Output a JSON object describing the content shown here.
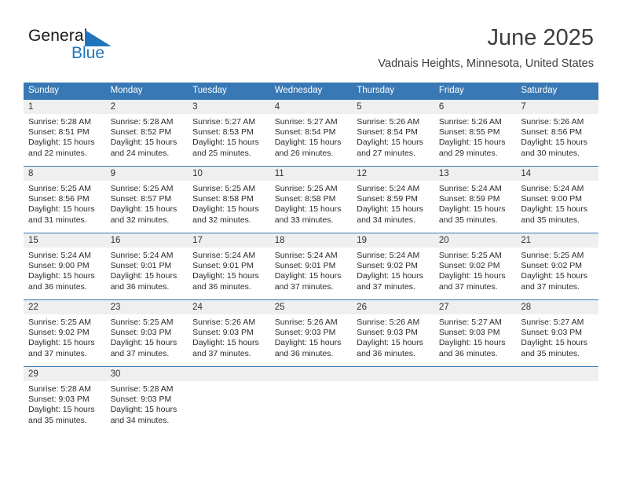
{
  "brand": {
    "name_part1": "General",
    "name_part2": "Blue",
    "mark": "triangle-logo-icon",
    "accent_color": "#2175bc"
  },
  "header": {
    "month_title": "June 2025",
    "location": "Vadnais Heights, Minnesota, United States"
  },
  "colors": {
    "header_row": "#3878b4",
    "day_band": "#efefef",
    "text": "#2b2b2b"
  },
  "weekday_headers": [
    "Sunday",
    "Monday",
    "Tuesday",
    "Wednesday",
    "Thursday",
    "Friday",
    "Saturday"
  ],
  "weeks": [
    [
      {
        "day": "1",
        "sunrise": "Sunrise: 5:28 AM",
        "sunset": "Sunset: 8:51 PM",
        "daylight1": "Daylight: 15 hours",
        "daylight2": "and 22 minutes."
      },
      {
        "day": "2",
        "sunrise": "Sunrise: 5:28 AM",
        "sunset": "Sunset: 8:52 PM",
        "daylight1": "Daylight: 15 hours",
        "daylight2": "and 24 minutes."
      },
      {
        "day": "3",
        "sunrise": "Sunrise: 5:27 AM",
        "sunset": "Sunset: 8:53 PM",
        "daylight1": "Daylight: 15 hours",
        "daylight2": "and 25 minutes."
      },
      {
        "day": "4",
        "sunrise": "Sunrise: 5:27 AM",
        "sunset": "Sunset: 8:54 PM",
        "daylight1": "Daylight: 15 hours",
        "daylight2": "and 26 minutes."
      },
      {
        "day": "5",
        "sunrise": "Sunrise: 5:26 AM",
        "sunset": "Sunset: 8:54 PM",
        "daylight1": "Daylight: 15 hours",
        "daylight2": "and 27 minutes."
      },
      {
        "day": "6",
        "sunrise": "Sunrise: 5:26 AM",
        "sunset": "Sunset: 8:55 PM",
        "daylight1": "Daylight: 15 hours",
        "daylight2": "and 29 minutes."
      },
      {
        "day": "7",
        "sunrise": "Sunrise: 5:26 AM",
        "sunset": "Sunset: 8:56 PM",
        "daylight1": "Daylight: 15 hours",
        "daylight2": "and 30 minutes."
      }
    ],
    [
      {
        "day": "8",
        "sunrise": "Sunrise: 5:25 AM",
        "sunset": "Sunset: 8:56 PM",
        "daylight1": "Daylight: 15 hours",
        "daylight2": "and 31 minutes."
      },
      {
        "day": "9",
        "sunrise": "Sunrise: 5:25 AM",
        "sunset": "Sunset: 8:57 PM",
        "daylight1": "Daylight: 15 hours",
        "daylight2": "and 32 minutes."
      },
      {
        "day": "10",
        "sunrise": "Sunrise: 5:25 AM",
        "sunset": "Sunset: 8:58 PM",
        "daylight1": "Daylight: 15 hours",
        "daylight2": "and 32 minutes."
      },
      {
        "day": "11",
        "sunrise": "Sunrise: 5:25 AM",
        "sunset": "Sunset: 8:58 PM",
        "daylight1": "Daylight: 15 hours",
        "daylight2": "and 33 minutes."
      },
      {
        "day": "12",
        "sunrise": "Sunrise: 5:24 AM",
        "sunset": "Sunset: 8:59 PM",
        "daylight1": "Daylight: 15 hours",
        "daylight2": "and 34 minutes."
      },
      {
        "day": "13",
        "sunrise": "Sunrise: 5:24 AM",
        "sunset": "Sunset: 8:59 PM",
        "daylight1": "Daylight: 15 hours",
        "daylight2": "and 35 minutes."
      },
      {
        "day": "14",
        "sunrise": "Sunrise: 5:24 AM",
        "sunset": "Sunset: 9:00 PM",
        "daylight1": "Daylight: 15 hours",
        "daylight2": "and 35 minutes."
      }
    ],
    [
      {
        "day": "15",
        "sunrise": "Sunrise: 5:24 AM",
        "sunset": "Sunset: 9:00 PM",
        "daylight1": "Daylight: 15 hours",
        "daylight2": "and 36 minutes."
      },
      {
        "day": "16",
        "sunrise": "Sunrise: 5:24 AM",
        "sunset": "Sunset: 9:01 PM",
        "daylight1": "Daylight: 15 hours",
        "daylight2": "and 36 minutes."
      },
      {
        "day": "17",
        "sunrise": "Sunrise: 5:24 AM",
        "sunset": "Sunset: 9:01 PM",
        "daylight1": "Daylight: 15 hours",
        "daylight2": "and 36 minutes."
      },
      {
        "day": "18",
        "sunrise": "Sunrise: 5:24 AM",
        "sunset": "Sunset: 9:01 PM",
        "daylight1": "Daylight: 15 hours",
        "daylight2": "and 37 minutes."
      },
      {
        "day": "19",
        "sunrise": "Sunrise: 5:24 AM",
        "sunset": "Sunset: 9:02 PM",
        "daylight1": "Daylight: 15 hours",
        "daylight2": "and 37 minutes."
      },
      {
        "day": "20",
        "sunrise": "Sunrise: 5:25 AM",
        "sunset": "Sunset: 9:02 PM",
        "daylight1": "Daylight: 15 hours",
        "daylight2": "and 37 minutes."
      },
      {
        "day": "21",
        "sunrise": "Sunrise: 5:25 AM",
        "sunset": "Sunset: 9:02 PM",
        "daylight1": "Daylight: 15 hours",
        "daylight2": "and 37 minutes."
      }
    ],
    [
      {
        "day": "22",
        "sunrise": "Sunrise: 5:25 AM",
        "sunset": "Sunset: 9:02 PM",
        "daylight1": "Daylight: 15 hours",
        "daylight2": "and 37 minutes."
      },
      {
        "day": "23",
        "sunrise": "Sunrise: 5:25 AM",
        "sunset": "Sunset: 9:03 PM",
        "daylight1": "Daylight: 15 hours",
        "daylight2": "and 37 minutes."
      },
      {
        "day": "24",
        "sunrise": "Sunrise: 5:26 AM",
        "sunset": "Sunset: 9:03 PM",
        "daylight1": "Daylight: 15 hours",
        "daylight2": "and 37 minutes."
      },
      {
        "day": "25",
        "sunrise": "Sunrise: 5:26 AM",
        "sunset": "Sunset: 9:03 PM",
        "daylight1": "Daylight: 15 hours",
        "daylight2": "and 36 minutes."
      },
      {
        "day": "26",
        "sunrise": "Sunrise: 5:26 AM",
        "sunset": "Sunset: 9:03 PM",
        "daylight1": "Daylight: 15 hours",
        "daylight2": "and 36 minutes."
      },
      {
        "day": "27",
        "sunrise": "Sunrise: 5:27 AM",
        "sunset": "Sunset: 9:03 PM",
        "daylight1": "Daylight: 15 hours",
        "daylight2": "and 36 minutes."
      },
      {
        "day": "28",
        "sunrise": "Sunrise: 5:27 AM",
        "sunset": "Sunset: 9:03 PM",
        "daylight1": "Daylight: 15 hours",
        "daylight2": "and 35 minutes."
      }
    ],
    [
      {
        "day": "29",
        "sunrise": "Sunrise: 5:28 AM",
        "sunset": "Sunset: 9:03 PM",
        "daylight1": "Daylight: 15 hours",
        "daylight2": "and 35 minutes."
      },
      {
        "day": "30",
        "sunrise": "Sunrise: 5:28 AM",
        "sunset": "Sunset: 9:03 PM",
        "daylight1": "Daylight: 15 hours",
        "daylight2": "and 34 minutes."
      },
      {
        "day": "",
        "sunrise": "",
        "sunset": "",
        "daylight1": "",
        "daylight2": ""
      },
      {
        "day": "",
        "sunrise": "",
        "sunset": "",
        "daylight1": "",
        "daylight2": ""
      },
      {
        "day": "",
        "sunrise": "",
        "sunset": "",
        "daylight1": "",
        "daylight2": ""
      },
      {
        "day": "",
        "sunrise": "",
        "sunset": "",
        "daylight1": "",
        "daylight2": ""
      },
      {
        "day": "",
        "sunrise": "",
        "sunset": "",
        "daylight1": "",
        "daylight2": ""
      }
    ]
  ]
}
